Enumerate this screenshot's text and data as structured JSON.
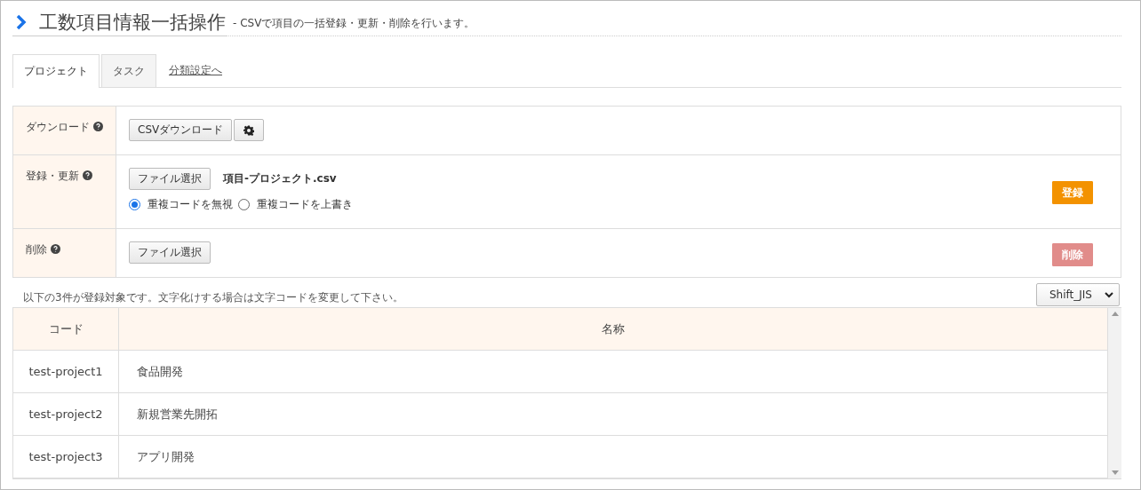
{
  "header": {
    "title": "工数項目情報一括操作",
    "subtitle": "- CSVで項目の一括登録・更新・削除を行います。"
  },
  "tabs": [
    {
      "label": "プロジェクト",
      "selected": true,
      "kind": "tab"
    },
    {
      "label": "タスク",
      "selected": false,
      "kind": "tab"
    },
    {
      "label": "分類設定へ",
      "selected": false,
      "kind": "link"
    }
  ],
  "form": [
    {
      "kind": "download",
      "label": "ダウンロード",
      "button": "CSVダウンロード"
    },
    {
      "kind": "register",
      "label": "登録・更新",
      "button": "ファイル選択",
      "file_name": "項目-プロジェクト.csv",
      "options": [
        {
          "label": "重複コードを無視",
          "selected": true
        },
        {
          "label": "重複コードを上書き",
          "selected": false
        }
      ],
      "action": "登録",
      "disabled": false
    },
    {
      "kind": "delete",
      "label": "削除",
      "button": "ファイル選択",
      "action": "削除",
      "disabled": true
    }
  ],
  "note": "以下の3件が登録対象です。文字化けする場合は文字コードを変更して下さい。",
  "encoding": {
    "value": "Shift_JIS"
  },
  "table": {
    "columns": [
      "コード",
      "名称"
    ],
    "rows": [
      [
        "test-project1",
        "食品開発"
      ],
      [
        "test-project2",
        "新規営業先開拓"
      ],
      [
        "test-project3",
        "アプリ開発"
      ]
    ]
  }
}
